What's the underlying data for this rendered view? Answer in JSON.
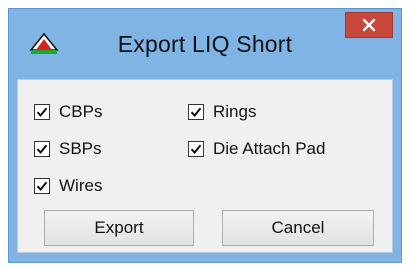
{
  "window": {
    "title": "Export LIQ Short",
    "close_label": "×"
  },
  "options": {
    "cbps": {
      "label": "CBPs",
      "checked": true
    },
    "rings": {
      "label": "Rings",
      "checked": true
    },
    "sbps": {
      "label": "SBPs",
      "checked": true
    },
    "die_attach_pad": {
      "label": "Die Attach Pad",
      "checked": true
    },
    "wires": {
      "label": "Wires",
      "checked": true
    }
  },
  "buttons": {
    "export_label": "Export",
    "cancel_label": "Cancel"
  },
  "icons": {
    "app": "app-logo-icon",
    "close": "close-icon",
    "check": "checkmark-icon"
  },
  "colors": {
    "titlebar": "#7fb4e4",
    "close_button": "#c7473b",
    "client_area": "#f0f0f0"
  }
}
